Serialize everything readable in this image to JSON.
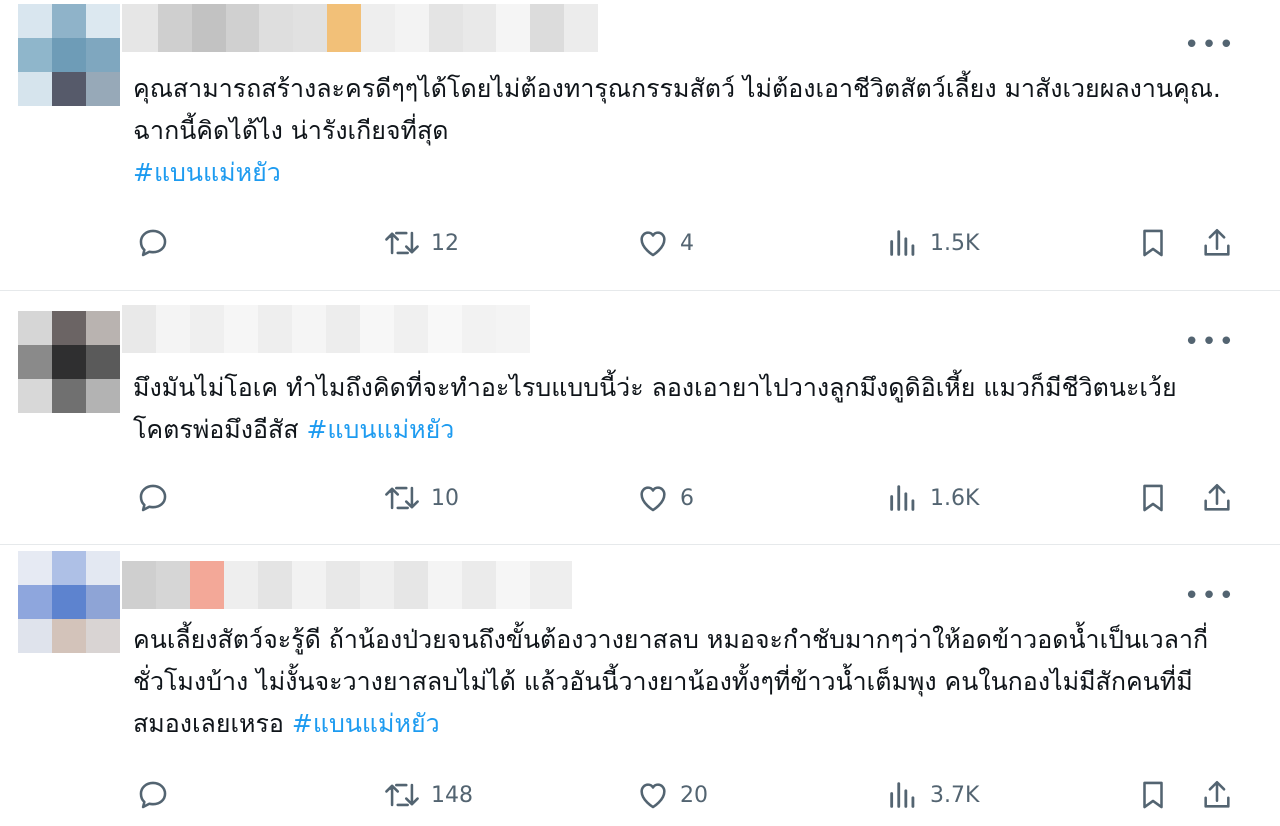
{
  "tweets": [
    {
      "text": "คุณสามารถสร้างละครดีๆๆได้โดยไม่ต้องทารุณกรรมสัตว์  ไม่ต้องเอาชีวิตสัตว์เลี้ยง มาสังเวยผลงานคุณ. ฉากนี้คิดได้ไง  น่ารังเกียจที่สุด",
      "hashtag": "#แบนแม่หยัว",
      "retweets": "12",
      "likes": "4",
      "views": "1.5K"
    },
    {
      "text": "มึงมันไม่โอเค ทำไมถึงคิดที่จะทำอะไรบแบบนี้ว่ะ ลองเอายาไปวางลูกมึงดูดิอิเหี้ย แมวก็มีชีวิตนะเว้ย โคตรพ่อมึงอีสัส ",
      "hashtag": "#แบนแม่หยัว",
      "retweets": "10",
      "likes": "6",
      "views": "1.6K"
    },
    {
      "text": "คนเลี้ยงสัตว์จะรู้ดี ถ้าน้องป่วยจนถึงขั้นต้องวางยาสลบ หมอจะกำชับมากๆว่าให้อดข้าวอดน้ำเป็นเวลากี่ชั่วโมงบ้าง ไม่งั้นจะวางยาสลบไม่ได้ แล้วอันนี้วางยาน้องทั้งๆที่ข้าวน้ำเต็มพุง คนในกองไม่มีสักคนที่มีสมองเลยเหรอ  ",
      "hashtag": "#แบนแม่หยัว",
      "retweets": "148",
      "likes": "20",
      "views": "3.7K"
    }
  ],
  "more_label": "•••",
  "colors": {
    "hashtag": "#1d9bf0",
    "icon": "#536471",
    "text": "#0f1419"
  },
  "icons": [
    "reply-icon",
    "retweet-icon",
    "like-icon",
    "views-icon",
    "bookmark-icon",
    "share-icon"
  ]
}
